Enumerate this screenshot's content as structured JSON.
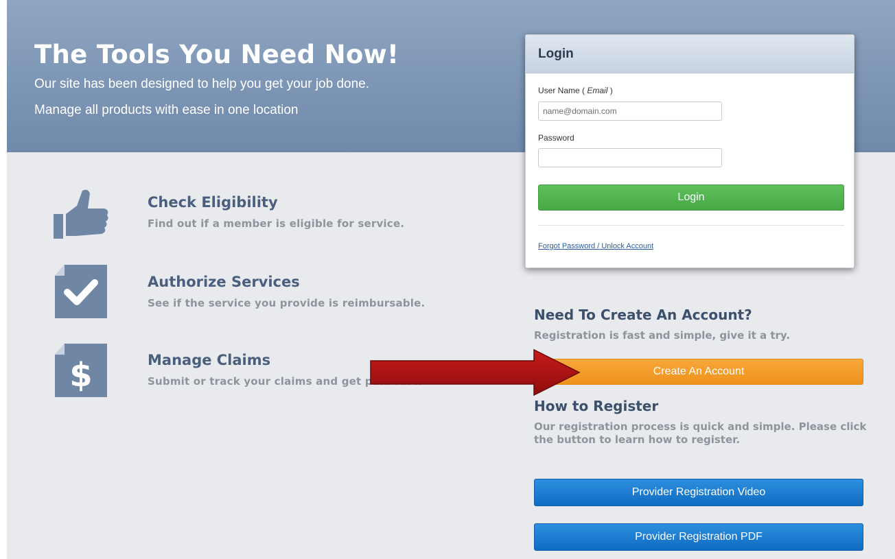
{
  "hero": {
    "title": "The Tools You Need Now!",
    "subtitle_1": "Our site has been designed to help you get your job done.",
    "subtitle_2": "Manage all products with ease in one location"
  },
  "features": [
    {
      "icon": "thumbs-up-icon",
      "title": "Check Eligibility",
      "description": "Find out if a member is eligible for service."
    },
    {
      "icon": "checkmark-document-icon",
      "title": "Authorize Services",
      "description": "See if the service you provide is reimbursable."
    },
    {
      "icon": "dollar-document-icon",
      "title": "Manage Claims",
      "description": "Submit or track your claims and get paid fast."
    }
  ],
  "login": {
    "title": "Login",
    "username_label": "User Name",
    "username_hint": "Email",
    "username_placeholder": "name@domain.com",
    "password_label": "Password",
    "password_value": "",
    "button_label": "Login",
    "forgot_link": "Forgot Password / Unlock Account"
  },
  "create_account": {
    "title": "Need To Create An Account?",
    "text": "Registration is fast and simple, give it a try.",
    "button_label": "Create An Account"
  },
  "how_to_register": {
    "title": "How to Register",
    "text": "Our registration process is quick and simple. Please click the button to learn how to register.",
    "video_button_label": "Provider Registration Video",
    "pdf_button_label": "Provider Registration PDF"
  },
  "annotation": {
    "icon": "red-arrow-icon",
    "color": "#b31414"
  },
  "colors": {
    "hero": "#7f97b7",
    "login_button": "#4cae4c",
    "create_button": "#f39c26",
    "registration_button": "#1478cf"
  }
}
